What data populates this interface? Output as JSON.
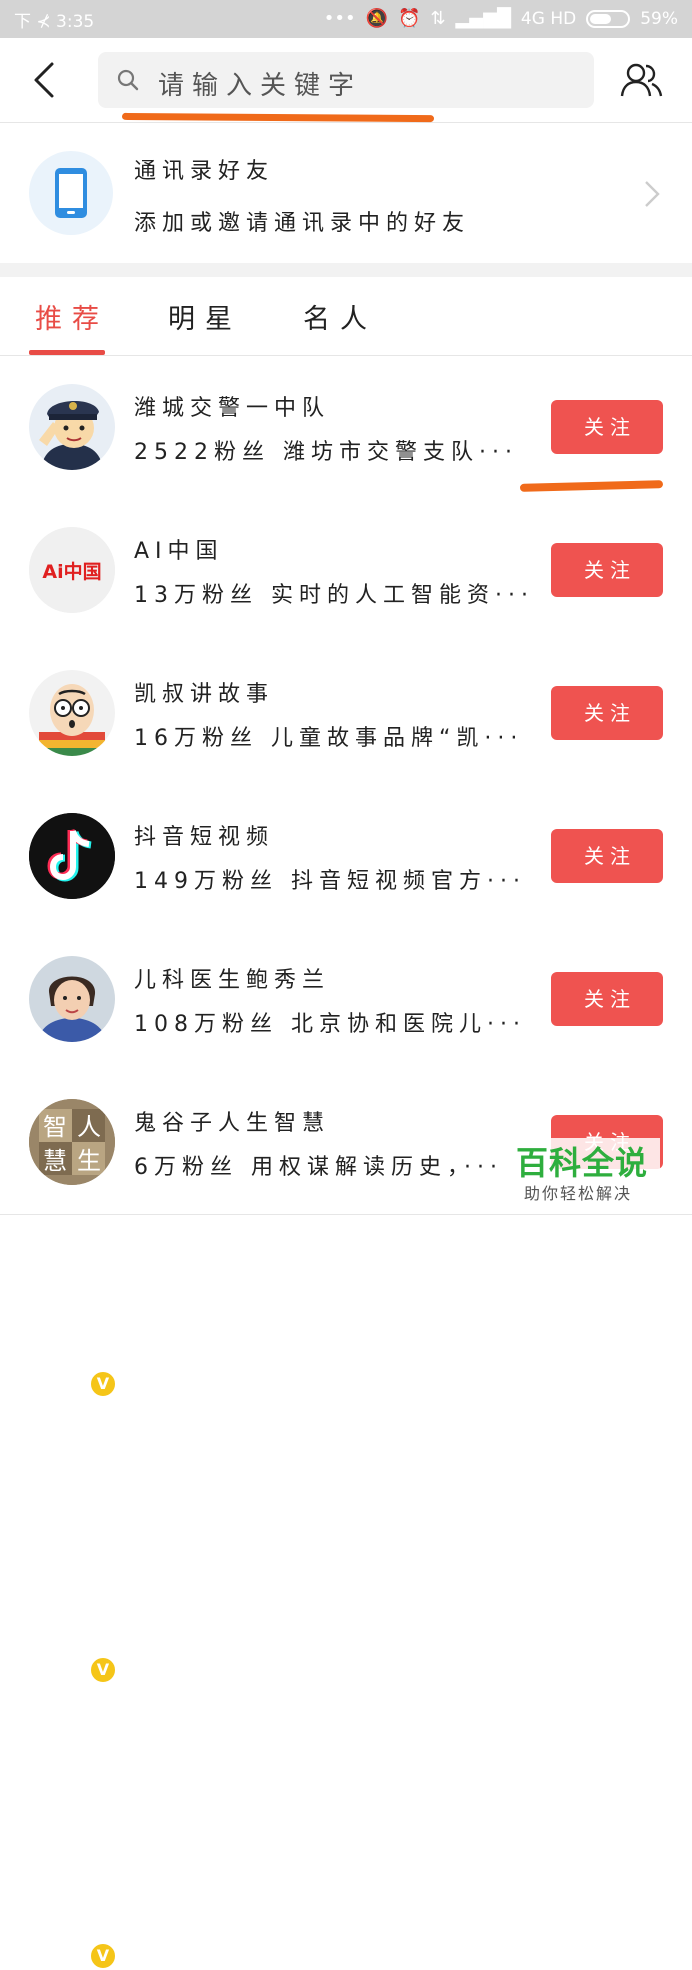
{
  "status_bar": {
    "left_text": "下 ⊀ 3:35",
    "network": "4G HD",
    "battery_text": "59%",
    "battery_level": 0.59
  },
  "header": {
    "search_placeholder": "请输入关键字"
  },
  "contacts": {
    "title": "通讯录好友",
    "subtitle": "添加或邀请通讯录中的好友"
  },
  "tabs": [
    {
      "label": "推荐",
      "active": true
    },
    {
      "label": "明星",
      "active": false
    },
    {
      "label": "名人",
      "active": false
    }
  ],
  "list": [
    {
      "name": "潍城交警一中队",
      "desc": "2522粉丝 潍坊市交警支队···",
      "button": "关注",
      "avatar": "police-cartoon",
      "verified": false
    },
    {
      "name": "AI中国",
      "desc": "13万粉丝 实时的人工智能资···",
      "button": "关注",
      "avatar_text": "Ai中国",
      "verified": false
    },
    {
      "name": "凯叔讲故事",
      "desc": "16万粉丝 儿童故事品牌“凯···",
      "button": "关注",
      "avatar": "glasses-cartoon",
      "verified": true
    },
    {
      "name": "抖音短视频",
      "desc": "149万粉丝 抖音短视频官方···",
      "button": "关注",
      "avatar": "tiktok-logo",
      "verified": true
    },
    {
      "name": "儿科医生鲍秀兰",
      "desc": "108万粉丝 北京协和医院儿···",
      "button": "关注",
      "avatar": "doctor-photo",
      "verified": true
    },
    {
      "name": "鬼谷子人生智慧",
      "desc": "6万粉丝 用权谋解读历史，···",
      "button": "关注",
      "avatar_chars": [
        "智",
        "人",
        "慧",
        "生"
      ],
      "verified": false
    }
  ],
  "watermark": {
    "title": "百科全说",
    "subtitle": "助你轻松解决"
  },
  "colors": {
    "accent_red": "#ef5350",
    "tab_active": "#e84c46",
    "annotation_orange": "#f06a1a",
    "watermark_green": "#2eae3e"
  }
}
